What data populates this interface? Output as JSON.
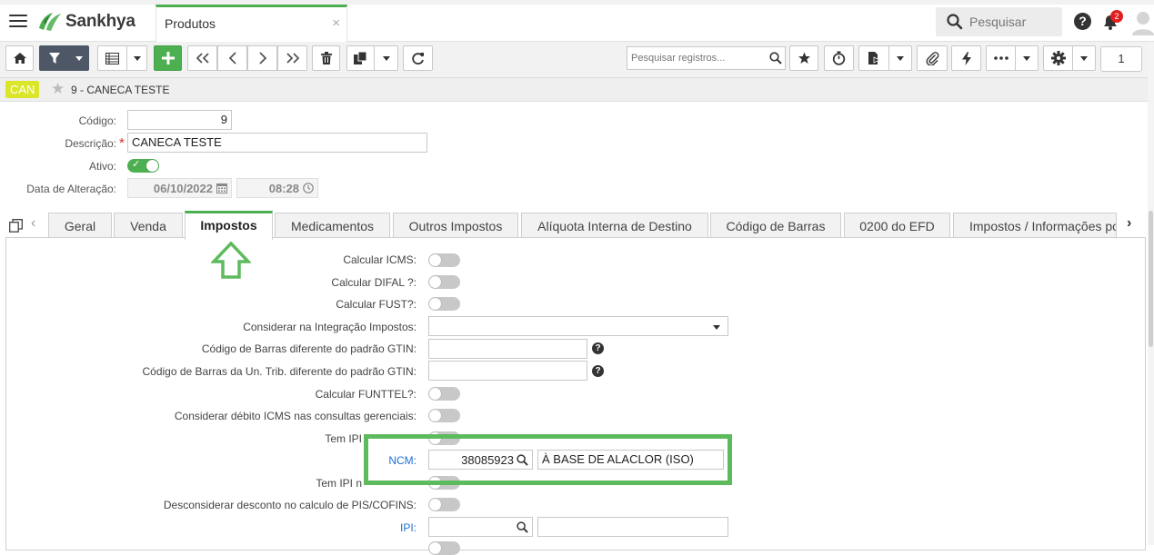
{
  "app": {
    "brand": "Sankhya",
    "tab_title": "Produtos",
    "tab_close": "×",
    "search_placeholder": "Pesquisar",
    "notification_count": "2"
  },
  "toolbar": {
    "registry_search_placeholder": "Pesquisar registros...",
    "page_number": "1"
  },
  "record": {
    "badge": "CAN",
    "title": "9 - CANECA TESTE"
  },
  "form": {
    "codigo_label": "Código:",
    "codigo_value": "9",
    "descricao_label": "Descrição:",
    "descricao_required": "*",
    "descricao_value": "CANECA  TESTE",
    "ativo_label": "Ativo:",
    "ativo_value": true,
    "data_label": "Data de Alteração:",
    "data_date": "06/10/2022",
    "data_time": "08:28"
  },
  "tabs": [
    {
      "label": "Geral"
    },
    {
      "label": "Venda"
    },
    {
      "label": "Impostos",
      "active": true
    },
    {
      "label": "Medicamentos"
    },
    {
      "label": "Outros Impostos"
    },
    {
      "label": "Alíquota Interna de Destino"
    },
    {
      "label": "Código de Barras"
    },
    {
      "label": "0200 do EFD"
    },
    {
      "label": "Impostos / Informações po"
    }
  ],
  "impostos": {
    "calcular_icms": "Calcular ICMS:",
    "calcular_difal": "Calcular DIFAL ?:",
    "calcular_fust": "Calcular FUST?:",
    "considerar_integracao": "Considerar na Integração Impostos:",
    "gtin": "Código de Barras diferente do padrão GTIN:",
    "gtin_trib": "Código de Barras da Un. Trib. diferente do padrão GTIN:",
    "calcular_funttel": "Calcular FUNTTEL?:",
    "considerar_debito": "Considerar débito ICMS nas consultas gerenciais:",
    "tem_ipi_1": "Tem IPI",
    "ncm_label": "NCM:",
    "ncm_code": "38085923",
    "ncm_desc": "À BASE DE ALACLOR (ISO)",
    "tem_ipi_2": "Tem IPI n",
    "desconsiderar_desconto": "Desconsiderar desconto no calculo de PIS/COFINS:",
    "ipi_label": "IPI:",
    "help": "?"
  },
  "colors": {
    "accent": "#4caf50",
    "link": "#1e6fd9",
    "badge": "#dbe62a",
    "highlight": "#5dbb5d",
    "toolbar_dark": "#4e5766"
  }
}
